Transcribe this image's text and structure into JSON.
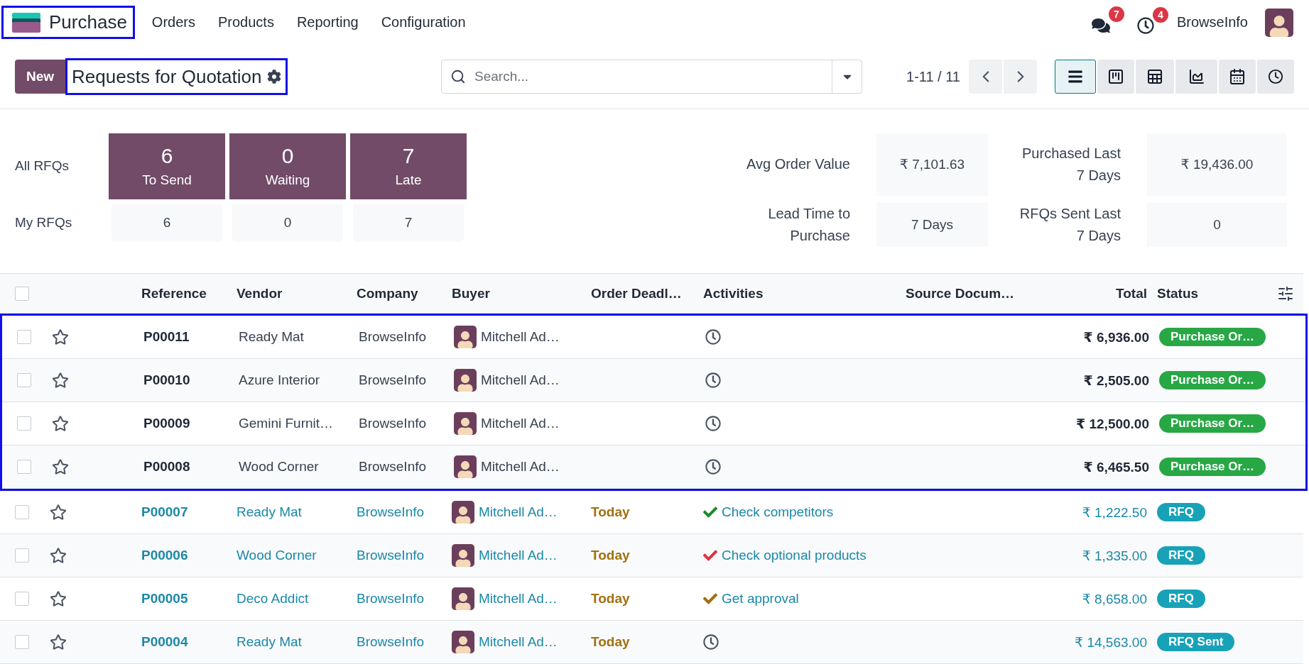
{
  "app": {
    "name": "Purchase",
    "highlighted": true
  },
  "menu": [
    "Orders",
    "Products",
    "Reporting",
    "Configuration"
  ],
  "systray": {
    "messages_count": "7",
    "activities_count": "4",
    "company": "BrowseInfo"
  },
  "control_panel": {
    "new_button": "New",
    "title": "Requests for Quotation",
    "title_highlighted": true,
    "search": {
      "placeholder": "Search..."
    },
    "pager": "1-11 / 11",
    "views": [
      {
        "kind": "list",
        "selected": true
      },
      {
        "kind": "kanban",
        "selected": false
      },
      {
        "kind": "pivot",
        "selected": false
      },
      {
        "kind": "graph",
        "selected": false
      },
      {
        "kind": "calendar",
        "selected": false
      },
      {
        "kind": "activity",
        "selected": false
      }
    ]
  },
  "all_rfqs": {
    "label": "All RFQs",
    "tiles": [
      {
        "count": "6",
        "label": "To Send"
      },
      {
        "count": "0",
        "label": "Waiting"
      },
      {
        "count": "7",
        "label": "Late"
      }
    ]
  },
  "my_rfqs": {
    "label": "My RFQs",
    "counts": [
      "6",
      "0",
      "7"
    ]
  },
  "kpis": [
    {
      "label": "Avg Order Value",
      "value": "₹ 7,101.63"
    },
    {
      "label": "Purchased Last 7 Days",
      "value": "₹ 19,436.00"
    },
    {
      "label": "Lead Time to Purchase",
      "value": "7 Days"
    },
    {
      "label": "RFQs Sent Last 7 Days",
      "value": "0"
    }
  ],
  "table": {
    "all_selected": false,
    "columns": [
      "Reference",
      "Vendor",
      "Company",
      "Buyer",
      "Order Deadl…",
      "Activities",
      "Source Docum…",
      "Total",
      "Status"
    ],
    "rows": [
      {
        "selected": false,
        "favorite": false,
        "highlighted": true,
        "kind": "confirmed",
        "reference": "P00011",
        "vendor": "Ready Mat",
        "company": "BrowseInfo",
        "buyer": "Mitchell Ad…",
        "activity": {
          "kind": "clock"
        },
        "total": "₹ 6,936.00",
        "status": {
          "label": "Purchase Or…",
          "color": "#28a745"
        }
      },
      {
        "selected": false,
        "favorite": false,
        "highlighted": true,
        "kind": "confirmed",
        "reference": "P00010",
        "vendor": "Azure Interior",
        "company": "BrowseInfo",
        "buyer": "Mitchell Ad…",
        "activity": {
          "kind": "clock"
        },
        "total": "₹ 2,505.00",
        "status": {
          "label": "Purchase Or…",
          "color": "#28a745"
        }
      },
      {
        "selected": false,
        "favorite": false,
        "highlighted": true,
        "kind": "confirmed",
        "reference": "P00009",
        "vendor": "Gemini Furnit…",
        "company": "BrowseInfo",
        "buyer": "Mitchell Ad…",
        "activity": {
          "kind": "clock"
        },
        "total": "₹ 12,500.00",
        "status": {
          "label": "Purchase Or…",
          "color": "#28a745"
        }
      },
      {
        "selected": false,
        "favorite": false,
        "highlighted": true,
        "kind": "confirmed",
        "reference": "P00008",
        "vendor": "Wood Corner",
        "company": "BrowseInfo",
        "buyer": "Mitchell Ad…",
        "activity": {
          "kind": "clock"
        },
        "total": "₹ 6,465.50",
        "status": {
          "label": "Purchase Or…",
          "color": "#28a745"
        }
      },
      {
        "selected": false,
        "favorite": false,
        "highlighted": false,
        "kind": "draft",
        "reference": "P00007",
        "vendor": "Ready Mat",
        "company": "BrowseInfo",
        "buyer": "Mitchell Ad…",
        "deadline": "Today",
        "activity": {
          "kind": "check",
          "color": "#1e8a2e",
          "label": "Check competitors"
        },
        "total": "₹ 1,222.50",
        "status": {
          "label": "RFQ",
          "color": "#17a2b8"
        }
      },
      {
        "selected": false,
        "favorite": false,
        "highlighted": false,
        "kind": "draft",
        "reference": "P00006",
        "vendor": "Wood Corner",
        "company": "BrowseInfo",
        "buyer": "Mitchell Ad…",
        "deadline": "Today",
        "activity": {
          "kind": "check",
          "color": "#dc3545",
          "label": "Check optional products"
        },
        "total": "₹ 1,335.00",
        "status": {
          "label": "RFQ",
          "color": "#17a2b8"
        }
      },
      {
        "selected": false,
        "favorite": false,
        "highlighted": false,
        "kind": "draft",
        "reference": "P00005",
        "vendor": "Deco Addict",
        "company": "BrowseInfo",
        "buyer": "Mitchell Ad…",
        "deadline": "Today",
        "activity": {
          "kind": "check",
          "color": "#a0700f",
          "label": "Get approval"
        },
        "total": "₹ 8,658.00",
        "status": {
          "label": "RFQ",
          "color": "#17a2b8"
        }
      },
      {
        "selected": false,
        "favorite": false,
        "highlighted": false,
        "kind": "draft",
        "reference": "P00004",
        "vendor": "Ready Mat",
        "company": "BrowseInfo",
        "buyer": "Mitchell Ad…",
        "deadline": "Today",
        "activity": {
          "kind": "clock"
        },
        "total": "₹ 14,563.00",
        "status": {
          "label": "RFQ Sent",
          "color": "#17a2b8"
        }
      }
    ]
  }
}
